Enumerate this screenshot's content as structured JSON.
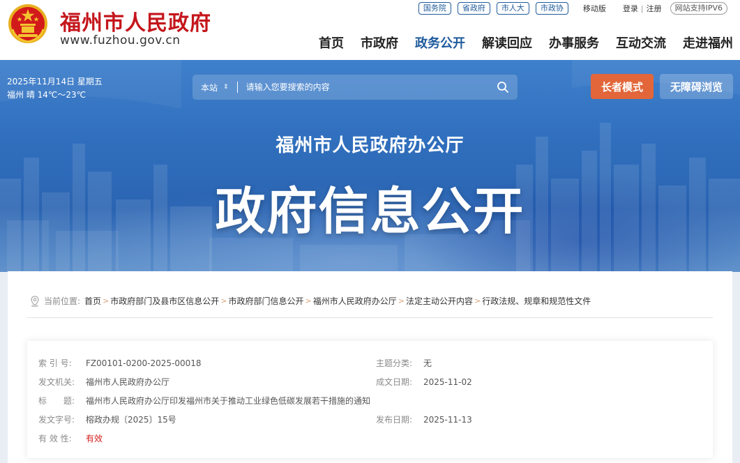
{
  "header": {
    "site_name": "福州市人民政府",
    "site_url": "www.fuzhou.gov.cn",
    "top_pills": [
      "国务院",
      "省政府",
      "市人大",
      "市政协"
    ],
    "mobile_label": "移动版",
    "login_label": "登录",
    "separator": "|",
    "register_label": "注册",
    "ipv6_label": "网站支持IPV6",
    "nav": [
      "首页",
      "市政府",
      "政务公开",
      "解读回应",
      "办事服务",
      "互动交流",
      "走进福州"
    ],
    "active_nav": "政务公开"
  },
  "banner": {
    "date_line": "2025年11月14日 星期五",
    "weather_line": "福州 晴 14℃～23℃",
    "search_scope": "本站",
    "search_scope_arrow": "⇕",
    "search_placeholder": "请输入您要搜索的内容",
    "elder_mode_label": "长者模式",
    "accessible_label": "无障碍浏览",
    "subtitle": "福州市人民政府办公厅",
    "title": "政府信息公开"
  },
  "breadcrumb": {
    "label": "当前位置:",
    "items": [
      "首页",
      "市政府部门及县市区信息公开",
      "市政府部门信息公开",
      "福州市人民政府办公厅",
      "法定主动公开内容",
      "行政法规、规章和规范性文件"
    ],
    "separator": ">"
  },
  "document_info": {
    "index_label": "索 引 号:",
    "index_value": "FZ00101-0200-2025-00018",
    "topic_label": "主题分类:",
    "topic_value": "无",
    "issuer_label": "发文机关:",
    "issuer_value": "福州市人民政府办公厅",
    "created_label": "成文日期:",
    "created_value": "2025-11-02",
    "title_label": "标　　题:",
    "title_value": "福州市人民政府办公厅印发福州市关于推动工业绿色低碳发展若干措施的通知",
    "docno_label": "发文字号:",
    "docno_value": "榕政办规〔2025〕15号",
    "published_label": "发布日期:",
    "published_value": "2025-11-13",
    "validity_label": "有 效 性:",
    "validity_value": "有效"
  },
  "colors": {
    "brand_red": "#c4161c",
    "nav_blue": "#1f5a9c",
    "elder_orange": "#e2663a",
    "validity_red": "#d61c1c"
  },
  "icons": [
    "national-emblem-icon",
    "search-icon",
    "location-pin-icon"
  ]
}
